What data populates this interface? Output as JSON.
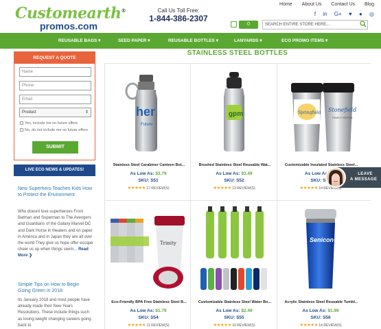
{
  "header": {
    "logo_top": "Customearth",
    "logo_tm": "®",
    "logo_bottom": "promos.com",
    "toll_label": "Call Us Toll Free:",
    "toll_number": "1-844-386-2307",
    "links": [
      "Home",
      "About Us",
      "Contact Us",
      "Blog"
    ],
    "social_icons": [
      "facebook-icon",
      "linkedin-icon",
      "google-plus-icon",
      "twitter-icon",
      "pinterest-icon",
      "instagram-icon"
    ],
    "cart_count": "0",
    "search_placeholder": "SEARCH ENTIRE STORE HERE..."
  },
  "nav": {
    "items": [
      "REUSABLE BAGS",
      "SEED PAPER",
      "REUSABLE BOTTLES",
      "LANYARDS",
      "ECO PROMO ITEMS"
    ]
  },
  "quote": {
    "heading": "REQUEST A QUOTE",
    "name_placeholder": "Name",
    "phone_placeholder": "Phone",
    "email_placeholder": "Email",
    "product_value": "Product",
    "opt_yes": "Yes, include me on future offers",
    "opt_no": "No, do not include me on future offers",
    "submit": "SUBMIT"
  },
  "news": {
    "heading": "LIVE ECO NEWS & UPDATES!",
    "posts": [
      {
        "title": "New Superhero Teaches Kids How to Protect the Environment",
        "body": "Who doesnt love superheroes From Batman and Superman to The Avengers and Guardians of the Galaxy Marvel DC and Dark Horse in theaters and on paper in America and in Japan they are all over the world They give us hope offer escape cheer us up when things seem...",
        "read_more": "Read More ❯"
      },
      {
        "title": "Simple Tips on How to Begin Going Green in 2018",
        "body": "Its January 2018 and most people have already made their New Years Resolutions. These include things such as losing weight changing careers going back to"
      }
    ]
  },
  "main": {
    "title": "STAINLESS STEEL BOTTLES",
    "price_label": "As Low As:",
    "sku_label": "SKU:",
    "products": [
      {
        "name": "Stainless Steel Carabiner Canteen Bot...",
        "price": "$3.79",
        "sku": "S51",
        "stars": "★★★★★",
        "reviews": "17 REVIEW(S)"
      },
      {
        "name": "Brushed Stainless Steel Reusable Wat...",
        "price": "$3.49",
        "sku": "S52",
        "stars": "★★★★★",
        "reviews": "13 REVIEW(S)"
      },
      {
        "name": "Customizable Insulated Stainless Steel...",
        "price": "$...",
        "sku": "S53",
        "stars": "★★★★★",
        "reviews": "14 REVIEW(S)"
      },
      {
        "name": "Eco-Friendly BPA Free Stainless Steel B...",
        "price": "$1.79",
        "sku": "S54",
        "stars": "★★★★★",
        "reviews": "11 REVIEW(S)"
      },
      {
        "name": "Customizable Stainless Steel Water Bo...",
        "price": "$2.49",
        "sku": "S55",
        "stars": "★★★★★",
        "reviews": "16 REVIEW(S)"
      },
      {
        "name": "Acrylic Stainless Steel Reusable Tumbl...",
        "price": "$1.99",
        "sku": "S56",
        "stars": "★★★★★",
        "reviews": "14 REVIEW(S)"
      }
    ]
  },
  "chat": {
    "line1": "LEAVE",
    "line2": "A MESSAGE"
  },
  "colors": {
    "brand_green": "#5aa832",
    "brand_blue": "#1e4a8c",
    "quote_orange": "#e8643d",
    "star": "#f5a623"
  }
}
